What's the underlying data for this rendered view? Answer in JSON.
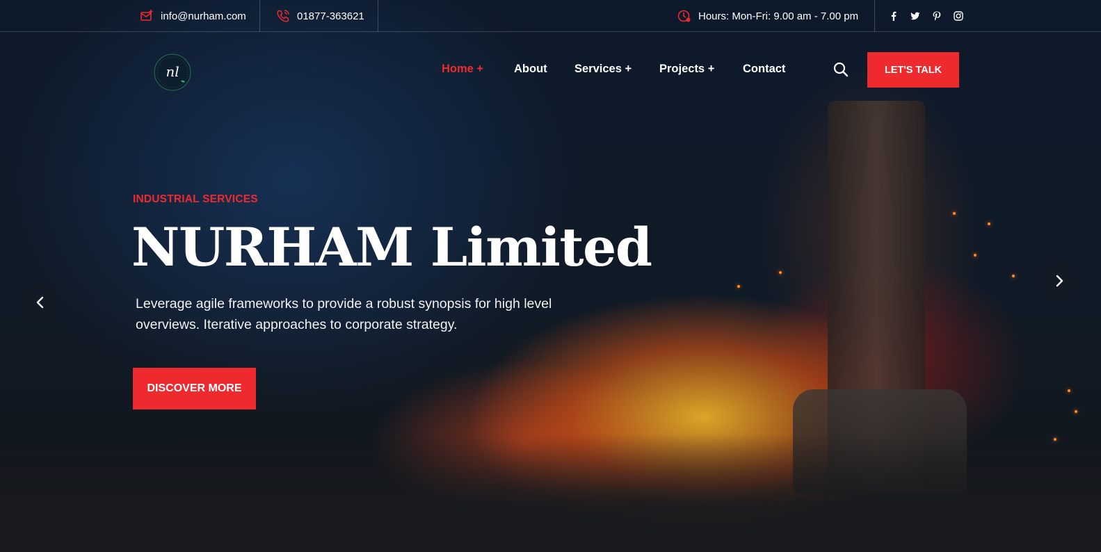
{
  "colors": {
    "accent": "#ee2a2f",
    "text": "#ffffff"
  },
  "topbar": {
    "email": "info@nurham.com",
    "phone": "01877-363621",
    "hours": "Hours: Mon-Fri: 9.00 am - 7.00 pm",
    "email_icon": "mail-icon",
    "phone_icon": "phone-icon",
    "hours_icon": "clock-icon",
    "social": [
      "facebook-icon",
      "twitter-icon",
      "pinterest-icon",
      "instagram-icon"
    ]
  },
  "brand": {
    "logo_text": "nl"
  },
  "nav": {
    "items": [
      {
        "label": "Home +",
        "active": true
      },
      {
        "label": "About",
        "active": false
      },
      {
        "label": "Services +",
        "active": false
      },
      {
        "label": "Projects +",
        "active": false
      },
      {
        "label": "Contact",
        "active": false
      }
    ],
    "search_icon": "search-icon",
    "cta_label": "LET'S TALK"
  },
  "hero": {
    "eyebrow": "INDUSTRIAL SERVICES",
    "title": "NURHAM Limited",
    "lead": "Leverage agile frameworks to provide a robust synopsis for high level overviews. Iterative approaches to corporate strategy.",
    "button_label": "DISCOVER MORE",
    "prev_icon": "chevron-left-icon",
    "next_icon": "chevron-right-icon"
  }
}
